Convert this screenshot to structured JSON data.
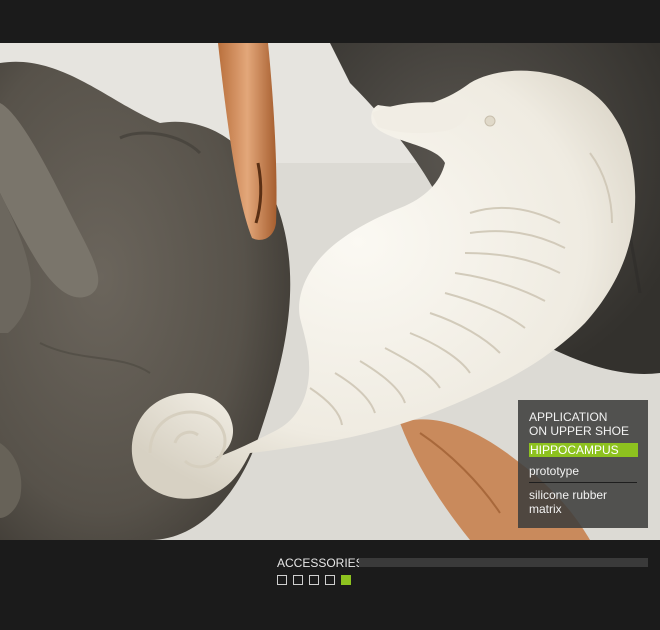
{
  "info_panel": {
    "title_lines": [
      "APPLICATION",
      "ON UPPER SHOE"
    ],
    "highlight": "HIPPOCAMPUS",
    "subtitle": "prototype",
    "description_lines": [
      "silicone rubber",
      "matrix"
    ]
  },
  "footer": {
    "section_label": "ACCESSORIES",
    "pager": {
      "total": 5,
      "active_index": 4
    }
  },
  "colors": {
    "accent": "#8dc21f",
    "background": "#1b1b1b",
    "panel": "#3e3e3c",
    "track": "#3a3a3a"
  },
  "photo": {
    "subject": "seahorse-sculpture"
  }
}
